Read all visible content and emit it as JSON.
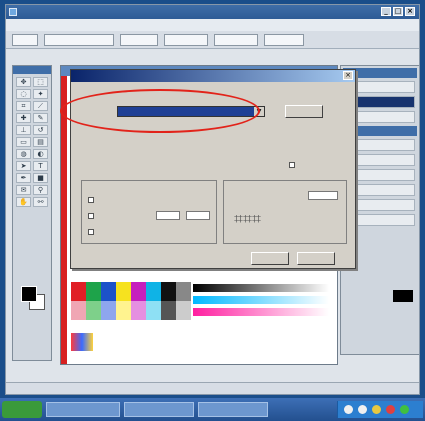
{
  "app": {
    "title": "",
    "menus": [
      "",
      "",
      "",
      "",
      "",
      "",
      "",
      "",
      ""
    ]
  },
  "dialog": {
    "title": "",
    "setting_label": "",
    "setting_value": "",
    "ok_label": "",
    "cancel_label": "",
    "info_lines": [
      "",
      "",
      "",
      ""
    ]
  },
  "statusbar": {
    "text": ""
  },
  "taskbar": {
    "start_label": "",
    "tasks": [
      "",
      "",
      ""
    ]
  },
  "colors": {
    "accent": "#2e5b95",
    "highlight": "#e2231a",
    "selection": "#1e3f95"
  },
  "icons": {
    "toolbox": [
      "move-icon",
      "marquee-icon",
      "lasso-icon",
      "wand-icon",
      "crop-icon",
      "slice-icon",
      "heal-icon",
      "brush-icon",
      "stamp-icon",
      "history-brush-icon",
      "eraser-icon",
      "gradient-icon",
      "blur-icon",
      "dodge-icon",
      "path-icon",
      "type-icon",
      "pen-icon",
      "shape-icon",
      "notes-icon",
      "eyedropper-icon",
      "hand-icon",
      "zoom-icon"
    ]
  }
}
